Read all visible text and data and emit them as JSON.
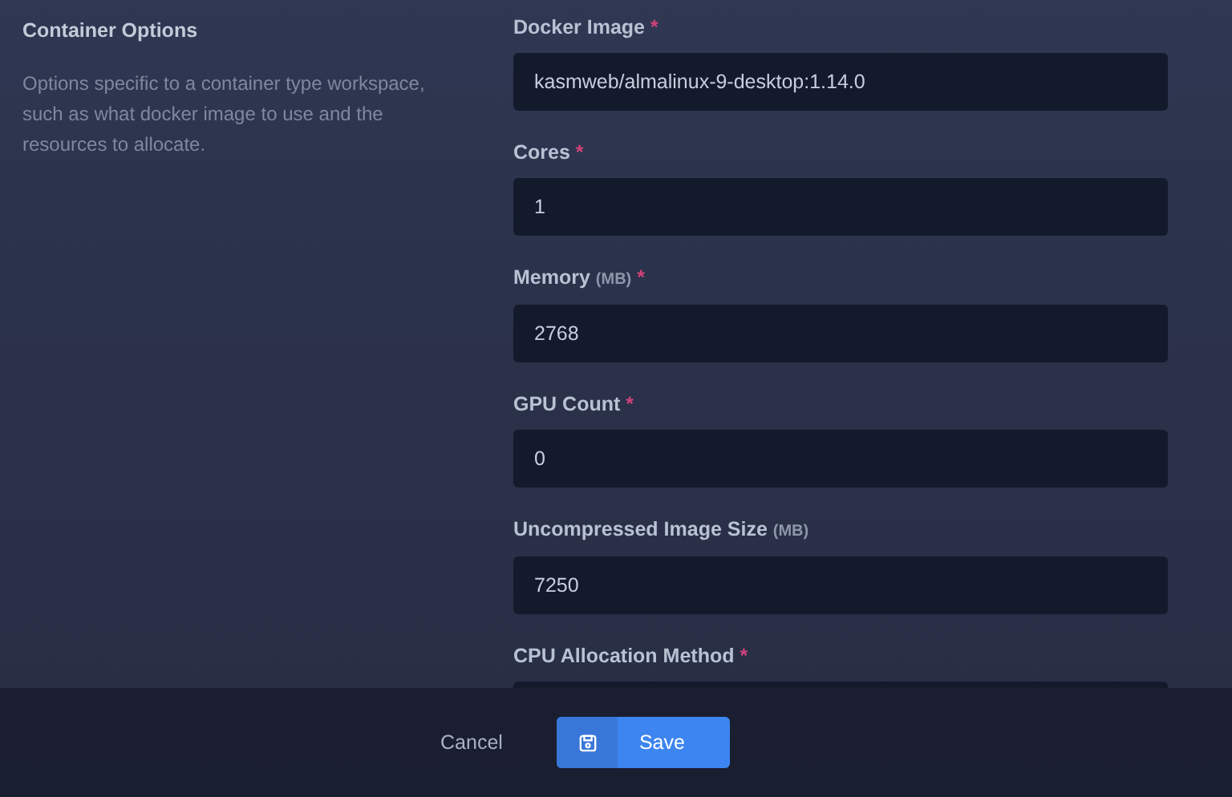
{
  "section": {
    "title": "Container Options",
    "description": "Options specific to a container type workspace, such as what docker image to use and the resources to allocate."
  },
  "fields": [
    {
      "kind": "text",
      "label": "Docker Image",
      "required_mark": "*",
      "value": "kasmweb/almalinux-9-desktop:1.14.0"
    },
    {
      "kind": "text",
      "label": "Cores",
      "required_mark": "*",
      "value": "1"
    },
    {
      "kind": "text",
      "label": "Memory",
      "unit": "(MB)",
      "required_mark": "*",
      "value": "2768"
    },
    {
      "kind": "text",
      "label": "GPU Count",
      "required_mark": "*",
      "value": "0"
    },
    {
      "kind": "text",
      "label": "Uncompressed Image Size",
      "unit": "(MB)",
      "value": "7250"
    },
    {
      "kind": "select",
      "label": "CPU Allocation Method",
      "required_mark": "*"
    }
  ],
  "footer": {
    "cancel": "Cancel",
    "save": "Save"
  }
}
